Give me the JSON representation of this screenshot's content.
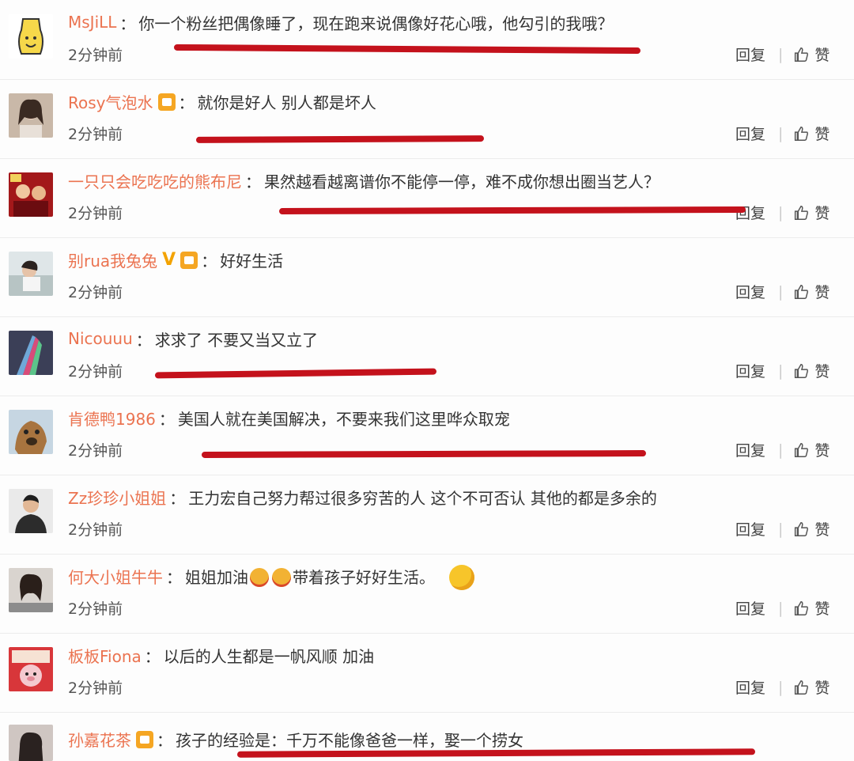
{
  "time_label": "2分钟前",
  "reply_label": "回复",
  "like_label": "赞",
  "comments": [
    {
      "user": "MsJiLL",
      "text": "你一个粉丝把偶像睡了，现在跑来说偶像好花心哦，他勾引的我哦？"
    },
    {
      "user": "Rosy气泡水",
      "text": "就你是好人 别人都是坏人"
    },
    {
      "user": "一只只会吃吃吃的熊布尼",
      "text": "果然越看越离谱你不能停一停，难不成你想出圈当艺人？"
    },
    {
      "user": "别rua我兔兔",
      "text": "好好生活"
    },
    {
      "user": "Nicouuu",
      "text": "求求了 不要又当又立了"
    },
    {
      "user": "肯德鸭1986",
      "text": "美国人就在美国解决，不要来我们这里哗众取宠"
    },
    {
      "user": "Zz珍珍小姐姐",
      "text": "王力宏自己努力帮过很多穷苦的人 这个不可否认 其他的都是多余的"
    },
    {
      "user": "何大小姐牛牛",
      "text": "姐姐加油",
      "text2": "带着孩子好好生活。"
    },
    {
      "user": "板板Fiona",
      "text": "以后的人生都是一帆风顺 加油"
    },
    {
      "user": "孙嘉花茶",
      "text": "孩子的经验是：千万不能像爸爸一样，娶一个捞女"
    }
  ],
  "colors": {
    "username": "#eb7350",
    "underline": "#c4121c"
  }
}
